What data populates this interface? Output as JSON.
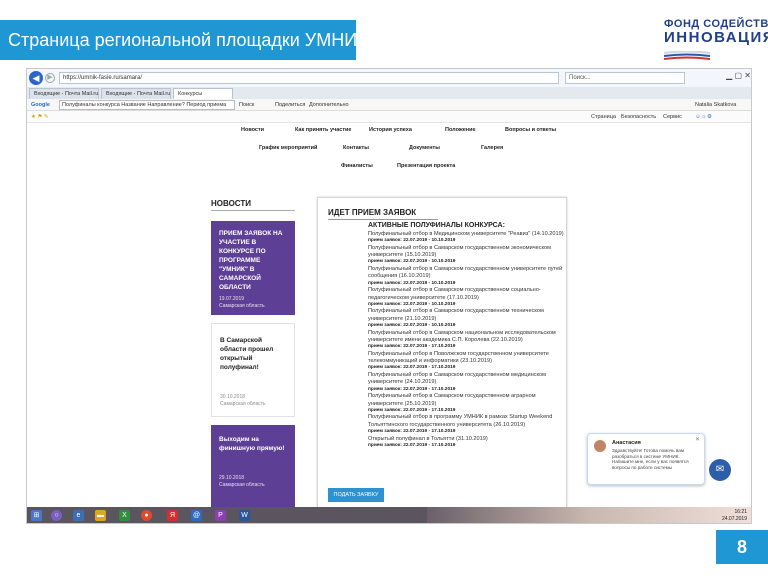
{
  "slide": {
    "title": "Страница региональной площадки УМНИК в СО",
    "page_number": "8",
    "logo": {
      "line1": "ФОНД СОДЕЙСТВИЯ",
      "line2": "ИННОВАЦИЯМ"
    }
  },
  "browser": {
    "url": "https://umnik-fasie.ru/samara/",
    "search_placeholder": "Поиск...",
    "tabs": [
      "Входящие - Почта Mail.ru",
      "Входящие - Почта Mail.ru",
      "Конкурсы"
    ],
    "toolbar": {
      "google": "Google",
      "google_query": "Полуфиналы конкурса Название Направление? Период приема",
      "search_btn": "Поиск",
      "share": "Поделиться",
      "more": "Дополнительно",
      "user": "Natalia Skatkova",
      "menu_page": "Страница",
      "menu_security": "Безопасность",
      "menu_service": "Сервис"
    }
  },
  "site": {
    "nav_row1": [
      "Новости",
      "Как принять участие",
      "История успеха",
      "Положение",
      "Вопросы и ответы"
    ],
    "nav_row2": [
      "График мероприятий",
      "Контакты",
      "Документы",
      "Галерея"
    ],
    "nav_row3": [
      "Финалисты",
      "Презентация проекта"
    ],
    "news_heading": "НОВОСТИ",
    "news": [
      {
        "title": "ПРИЕМ ЗАЯВОК НА УЧАСТИЕ В КОНКУРСЕ ПО ПРОГРАММЕ \"УМНИК\" В САМАРСКОЙ ОБЛАСТИ",
        "date": "19.07.2019",
        "region": "Самарская область"
      },
      {
        "title": "В Самарской области прошел открытый полуфинал!",
        "date": "30.10.2018",
        "region": "Самарская область"
      },
      {
        "title": "Выходим на финишную прямую!",
        "date": "29.10.2018",
        "region": "Самарская область"
      }
    ],
    "panel": {
      "title": "ИДЕТ ПРИЕМ ЗАЯВОК",
      "subtitle": "АКТИВНЫЕ ПОЛУФИНАЛЫ КОНКУРСА:",
      "items": [
        {
          "text": "Полуфинальный отбор в Медицинском университете \"Реавиз\" (14.10.2019)",
          "dates": "прием заявок: 22.07.2019 - 10.10.2019"
        },
        {
          "text": "Полуфинальный отбор в Самарском государственном экономическом университете (15.10.2019)",
          "dates": "прием заявок: 22.07.2019 - 10.10.2019"
        },
        {
          "text": "Полуфинальный отбор в Самарском государственном университете путей сообщения (16.10.2019)",
          "dates": "прием заявок: 22.07.2019 - 10.10.2019"
        },
        {
          "text": "Полуфинальный отбор в Самарском государственном социально-педагогическом университете (17.10.2019)",
          "dates": "прием заявок: 22.07.2019 - 10.10.2019"
        },
        {
          "text": "Полуфинальный отбор в Самарском государственном техническом университете (21.10.2019)",
          "dates": "прием заявок: 22.07.2019 - 10.10.2019"
        },
        {
          "text": "Полуфинальный отбор в Самарском национальном исследовательском университете имени академика С.П. Королева (22.10.2019)",
          "dates": "прием заявок: 22.07.2019 - 17.10.2019"
        },
        {
          "text": "Полуфинальный отбор в Поволжском государственном университете телекоммуникаций и информатики (23.10.2019)",
          "dates": "прием заявок: 22.07.2019 - 17.10.2019"
        },
        {
          "text": "Полуфинальный отбор в Самарском государственном медицинском университете (24.10.2019)",
          "dates": "прием заявок: 22.07.2019 - 17.10.2019"
        },
        {
          "text": "Полуфинальный отбор в Самарском государственном аграрном университете (25.10.2019)",
          "dates": "прием заявок: 22.07.2019 - 17.10.2019"
        },
        {
          "text": "Полуфинальный отбор в программу УМНИК в рамках Startup Weekend Тольяттинского государственного университета (26.10.2019)",
          "dates": "прием заявок: 22.07.2019 - 17.10.2019"
        },
        {
          "text": "Открытый полуфинал в Тольятти (31.10.2019)",
          "dates": "прием заявок: 22.07.2019 - 17.10.2019"
        }
      ],
      "apply_button": "ПОДАТЬ ЗАЯВКУ"
    },
    "chat": {
      "name": "Анастасия",
      "message": "Здравствуйте! Готова помочь вам разобраться в системе УМНИК. Напишите мне, если у вас появятся вопросы по работе системы"
    }
  },
  "taskbar": {
    "time": "16:21",
    "date": "24.07.2019"
  }
}
